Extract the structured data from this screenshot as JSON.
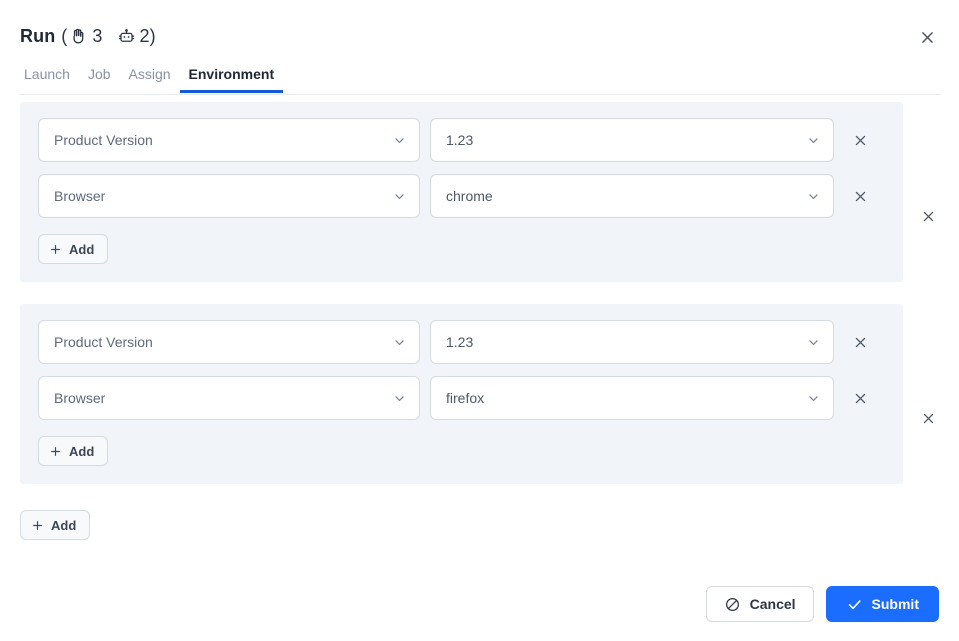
{
  "header": {
    "title_prefix": "Run",
    "paren_open": "(",
    "paren_close": ")",
    "manual_icon": "hand-icon",
    "manual_count": "3",
    "automation_icon": "robot-icon",
    "automation_count": "2",
    "close_icon": "close-icon"
  },
  "tabs": [
    {
      "label": "Launch",
      "active": false
    },
    {
      "label": "Job",
      "active": false
    },
    {
      "label": "Assign",
      "active": false
    },
    {
      "label": "Environment",
      "active": true
    }
  ],
  "colors": {
    "accent": "#1a6dff",
    "tab_underline": "#1259d6",
    "card_bg": "#f1f4f8",
    "border": "#d5dbe3",
    "text": "#2c3645",
    "muted_text": "#8894a6",
    "field_text": "#5d6b80"
  },
  "groups": [
    {
      "rows": [
        {
          "key": "Product Version",
          "value": "1.23",
          "key_chevron": "chevron-down-icon",
          "value_chevron": "chevron-down-icon",
          "remove_icon": "close-icon"
        },
        {
          "key": "Browser",
          "value": "chrome",
          "key_chevron": "chevron-down-icon",
          "value_chevron": "chevron-down-icon",
          "remove_icon": "close-icon"
        }
      ],
      "add_label": "Add",
      "add_icon": "plus-icon",
      "remove_icon": "close-icon"
    },
    {
      "rows": [
        {
          "key": "Product Version",
          "value": "1.23",
          "key_chevron": "chevron-down-icon",
          "value_chevron": "chevron-down-icon",
          "remove_icon": "close-icon"
        },
        {
          "key": "Browser",
          "value": "firefox",
          "key_chevron": "chevron-down-icon",
          "value_chevron": "chevron-down-icon",
          "remove_icon": "close-icon"
        }
      ],
      "add_label": "Add",
      "add_icon": "plus-icon",
      "remove_icon": "close-icon"
    }
  ],
  "outer_add": {
    "label": "Add",
    "icon": "plus-icon"
  },
  "footer": {
    "cancel_label": "Cancel",
    "cancel_icon": "ban-icon",
    "submit_label": "Submit",
    "submit_icon": "check-icon"
  }
}
